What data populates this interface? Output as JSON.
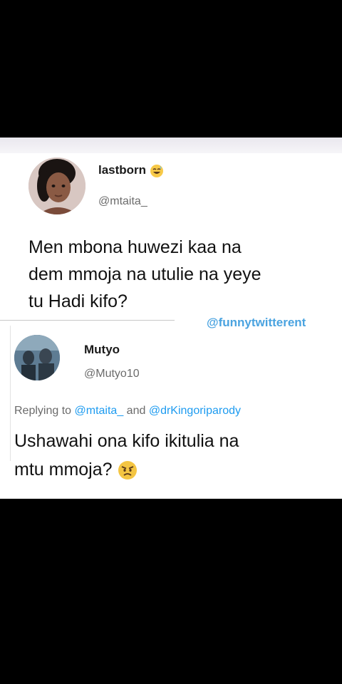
{
  "original": {
    "display_name": "lastborn",
    "handle": "@mtaita_",
    "text_lines": [
      "Men mbona huwezi kaa na",
      "dem mmoja na utulie na yeye",
      "tu Hadi kifo?"
    ]
  },
  "watermark": "@funnytwitterent",
  "reply": {
    "display_name": "Mutyo",
    "handle": "@Mutyo10",
    "replying_prefix": "Replying to",
    "mention_1": "@mtaita_",
    "conjunction": "and",
    "mention_2": "@drKingoriparody",
    "text_lines": [
      "Ushawahi ona kifo ikitulia na",
      "mtu mmoja?"
    ]
  },
  "icons": {
    "original_name_emoji": "sweat-smile-emoji-icon",
    "reply_emoji": "angry-face-emoji-icon"
  }
}
